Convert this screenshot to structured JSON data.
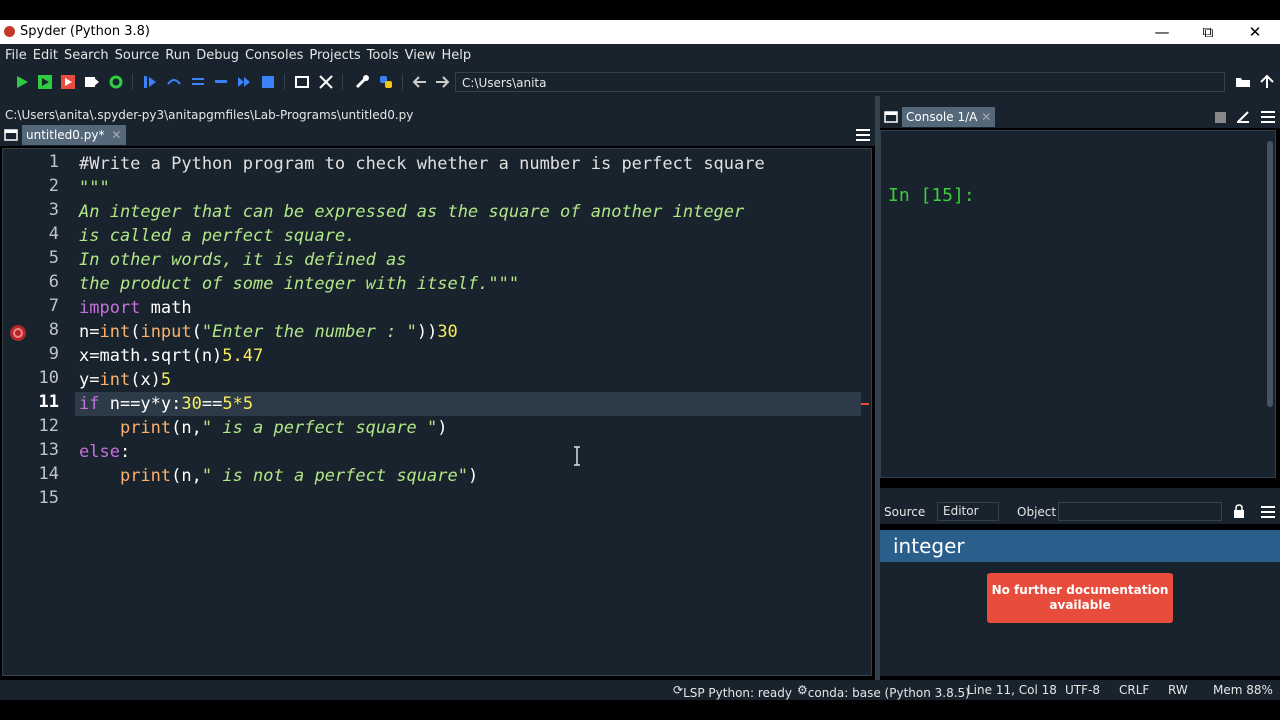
{
  "window": {
    "title": "Spyder (Python 3.8)"
  },
  "menu": [
    "File",
    "Edit",
    "Search",
    "Source",
    "Run",
    "Debug",
    "Consoles",
    "Projects",
    "Tools",
    "View",
    "Help"
  ],
  "toolbar": {
    "path": "C:\\Users\\anita"
  },
  "editor": {
    "file_path": "C:\\Users\\anita\\.spyder-py3\\anitapgmfiles\\Lab-Programs\\untitled0.py",
    "tab_label": "untitled0.py*",
    "line_numbers": [
      "1",
      "2",
      "3",
      "4",
      "5",
      "6",
      "7",
      "8",
      "9",
      "10",
      "11",
      "12",
      "13",
      "14",
      "15"
    ],
    "lines": {
      "l1": "#Write a Python program to check whether a number is perfect square",
      "l2": "\"\"\"",
      "l3": "An integer that can be expressed as the square of another integer",
      "l4": "is called a perfect square.",
      "l5": "In other words, it is defined as",
      "l6": "the product of some integer with itself.\"\"\"",
      "l7_kw": "import",
      "l7_rest": " math",
      "l8_a": "n=",
      "l8_b": "int",
      "l8_c": "(",
      "l8_d": "input",
      "l8_e": "(",
      "l8_f": "\"Enter the number : \"",
      "l8_g": "))",
      "l8_h": "30",
      "l9_a": "x=math.sqrt(n)",
      "l9_b": "5.47",
      "l10_a": "y=",
      "l10_b": "int",
      "l10_c": "(x)",
      "l10_d": "5",
      "l11_a": "if",
      "l11_b": " n==y*y:",
      "l11_c": "30",
      "l11_d": "==",
      "l11_e": "5*5",
      "l12_a": "    ",
      "l12_b": "print",
      "l12_c": "(n,",
      "l12_d": "\" is a perfect square \"",
      "l12_e": ")",
      "l13_a": "else",
      "l13_b": ":",
      "l14_a": "    ",
      "l14_b": "print",
      "l14_c": "(n,",
      "l14_d": "\" is not a perfect square\"",
      "l14_e": ")"
    },
    "current_line": "11"
  },
  "console": {
    "tab_label": "Console 1/A",
    "prompt": "In [15]:"
  },
  "help": {
    "source_label": "Source",
    "source_value": "Editor",
    "object_label": "Object",
    "heading": "integer",
    "no_doc": "No further documentation available"
  },
  "status": {
    "lsp": "LSP Python: ready",
    "conda": "conda: base (Python 3.8.5)",
    "position": "Line 11, Col 18",
    "encoding": "UTF-8",
    "eol": "CRLF",
    "permissions": "RW",
    "memory": "Mem 88%"
  },
  "colors": {
    "background": "#19232d",
    "accent": "#54687a",
    "prompt": "#3ecb3e",
    "error": "#e74c3c"
  }
}
